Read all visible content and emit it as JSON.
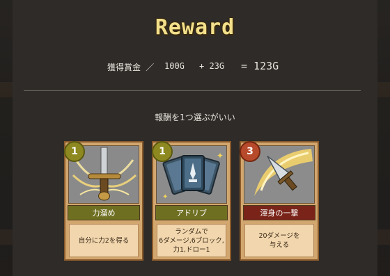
{
  "title": "Reward",
  "gold": {
    "label": "獲得賞金 ／",
    "base": "100G",
    "bonus": "+ 23G",
    "total": "= 123G"
  },
  "prompt": "報酬を1つ選ぶがいい",
  "cards": [
    {
      "cost": "1",
      "name": "力溜め",
      "desc": "自分に力2を得る",
      "art": "sword-hilt-icon"
    },
    {
      "cost": "1",
      "name": "アドリブ",
      "desc": "ランダムで\n6ダメージ,6ブロック,\n力1,ドロー1",
      "art": "cards-icon"
    },
    {
      "cost": "3",
      "name": "渾身の一撃",
      "desc": "20ダメージを\n与える",
      "art": "dagger-slash-icon"
    }
  ],
  "colors": {
    "title": "#f3e08b",
    "card_bg": "#d2a76f",
    "name_green": "#6f6f22",
    "name_red": "#7a2419"
  }
}
